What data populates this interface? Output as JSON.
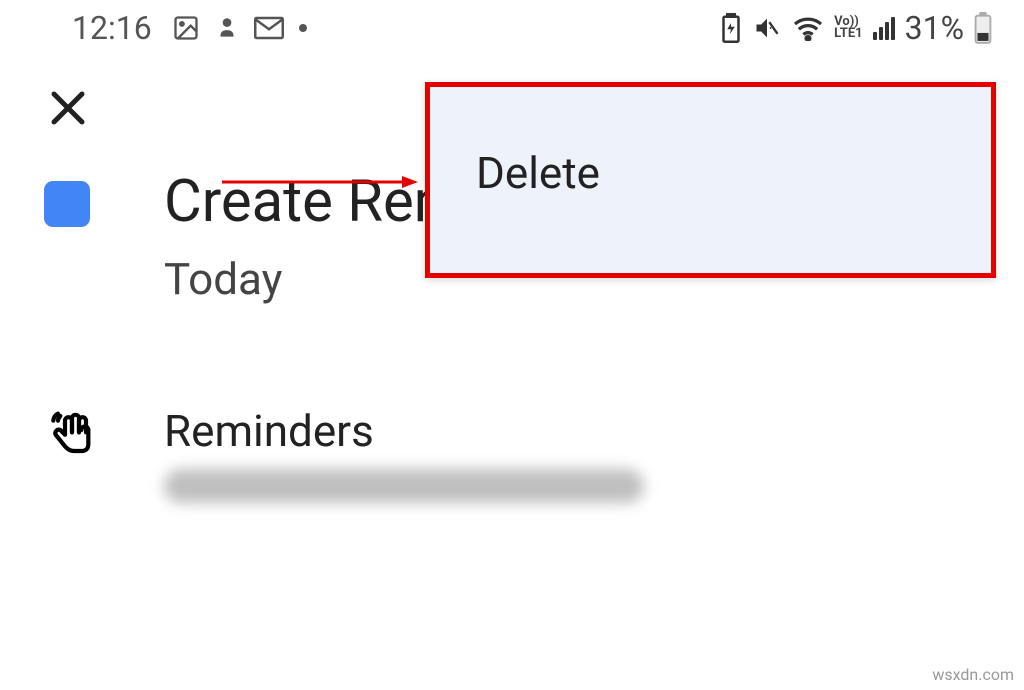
{
  "status_bar": {
    "time": "12:16",
    "battery_percent": "31%"
  },
  "volte": {
    "line1": "Vo))",
    "line2": "LTE1"
  },
  "menu": {
    "delete_label": "Delete"
  },
  "reminder": {
    "title": "Create Reminder",
    "date": "Today"
  },
  "section": {
    "label": "Reminders"
  },
  "watermark": "wsxdn.com"
}
